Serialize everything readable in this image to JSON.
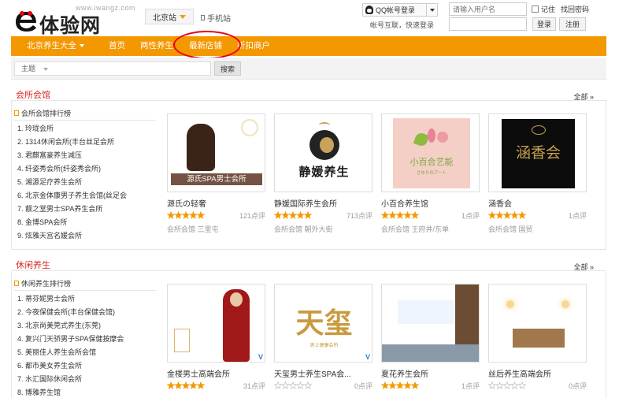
{
  "header": {
    "logo_url": "www.iwangz.com",
    "logo_text": "体验网",
    "city": "北京站",
    "mobile_link": "手机站",
    "qq_login": "QQ帐号登录",
    "qq_note": "帐号互联，快速登录",
    "username_placeholder": "请输入用户名",
    "remember": "记住",
    "find_password": "找回密码",
    "login": "登录",
    "register": "注册"
  },
  "nav": {
    "items": [
      "北京养生大全",
      "首页",
      "两性养生",
      "最新店铺",
      "折扣商户"
    ]
  },
  "search": {
    "select_value": "主题",
    "button": "搜索"
  },
  "sections": [
    {
      "title": "会所会馆",
      "all_label": "全部 »",
      "rank_title": "会所会馆排行榜",
      "rank": [
        "1. 玲珑会所",
        "2. 1314休闲会所(丰台丝足会所",
        "3. 君麒富豪养生减压",
        "4. 纤姿秀会所(纤姿秀会所)",
        "5. 湘源足疗养生会所",
        "6. 北京金体康男子养生会馆(丝足会",
        "7. 靓之堂男士SPA养生会所",
        "8. 金博SPA会所",
        "9. 炫雅天宫名媛会所"
      ],
      "cards": [
        {
          "name": "源氏の轻奢",
          "count": "121点评",
          "meta": "会所会馆 三里屯",
          "rating": 5,
          "image_label": "源氏SPA男士会所"
        },
        {
          "name": "静媛国际养生会所",
          "count": "713点评",
          "meta": "会所会馆 朝外大街",
          "rating": 5,
          "image_label": "静媛养生"
        },
        {
          "name": "小百合养生馆",
          "count": "1点评",
          "meta": "会所会馆 王府井/东单",
          "rating": 5,
          "image_label": "小百合艺能",
          "image_sub": "さゆりのアート"
        },
        {
          "name": "涵香会",
          "count": "1点评",
          "meta": "会所会馆 国贸",
          "rating": 5,
          "image_label": "涵香会"
        }
      ]
    },
    {
      "title": "休闲养生",
      "all_label": "全部 »",
      "rank_title": "休闲养生排行榜",
      "rank": [
        "1. 蒂芬妮男士会所",
        "2. 今夜保健会所(丰台保健会馆)",
        "3. 北京尚美莞式养生(东莞)",
        "4. 复兴门天骄男子SPA保健按摩会",
        "5. 美丽佳人养生会所会馆",
        "6. 都市美女养生会所",
        "7. 水汇国际休闲会所",
        "8. 博雅养生馆"
      ],
      "cards": [
        {
          "name": "金楼男士高端会所",
          "count": "31点评",
          "meta": "",
          "rating": 5,
          "verified": "V"
        },
        {
          "name": "天玺男士养生SPA会...",
          "count": "0点评",
          "meta": "",
          "rating": 0,
          "verified": "V",
          "image_label": "天玺",
          "image_sub": "男士健康会所"
        },
        {
          "name": "夏花养生会所",
          "count": "1点评",
          "meta": "",
          "rating": 5
        },
        {
          "name": "丝后养生高端会所",
          "count": "0点评",
          "meta": "",
          "rating": 0
        }
      ]
    }
  ],
  "colors": {
    "nav_bg": "#f39800",
    "section_title": "#d8241d",
    "star": "#f39800",
    "highlight_circle": "#e60012"
  }
}
